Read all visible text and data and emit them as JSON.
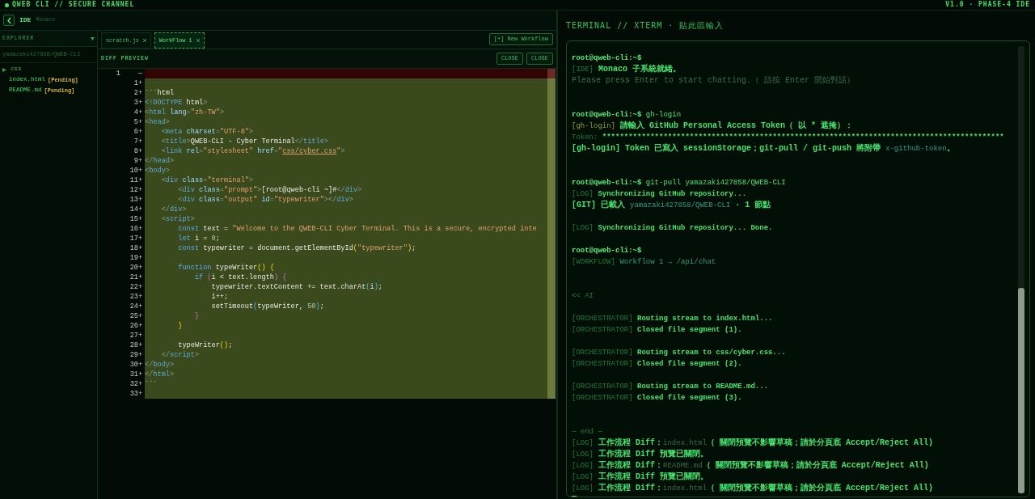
{
  "app": {
    "title": "QWEB CLI // SECURE CHANNEL",
    "version": "V1.0 · PHASE-4 IDE"
  },
  "ide": {
    "title": "IDE",
    "subtitle": "Monaco"
  },
  "explorer": {
    "title": "EXPLORER",
    "repo": "yamazaki427858/QWEB-CLI",
    "items": [
      {
        "kind": "folder",
        "name": "css",
        "expanded": false
      },
      {
        "kind": "file",
        "name": "index.html",
        "badge": "[Pending]"
      },
      {
        "kind": "file",
        "name": "README.md",
        "badge": "[Pending]"
      }
    ]
  },
  "tabs": [
    {
      "label": "scratch.js",
      "selected": false
    },
    {
      "label": "WorkFlow 1",
      "selected": true
    }
  ],
  "new_workflow_button": "[+] New Workflow",
  "diff_preview": {
    "title": "DIFF PREVIEW",
    "buttons": [
      "CLOSE",
      "CLOSE"
    ]
  },
  "code_lines": [
    {
      "kind": "removed",
      "old": "1",
      "sign": "—"
    },
    {
      "kind": "added",
      "new": "1",
      "sign": "+"
    },
    {
      "kind": "added",
      "new": "2",
      "sign": "+",
      "tokens": [
        {
          "kind": "plain",
          "text": "```html"
        }
      ]
    },
    {
      "kind": "added",
      "new": "3",
      "sign": "+",
      "tokens": [
        {
          "kind": "tag",
          "text": "<!DOCTYPE"
        },
        {
          "kind": "plain",
          "text": " html"
        },
        {
          "kind": "punct",
          "text": ">"
        }
      ]
    },
    {
      "kind": "added",
      "new": "4",
      "sign": "+",
      "tokens": [
        {
          "kind": "punct",
          "text": "<"
        },
        {
          "kind": "tag",
          "text": "html"
        },
        {
          "kind": "attr",
          "text": " lang"
        },
        {
          "kind": "punct",
          "text": "="
        },
        {
          "kind": "string",
          "text": "\"zh-TW\""
        },
        {
          "kind": "punct",
          "text": ">"
        }
      ]
    },
    {
      "kind": "added",
      "new": "5",
      "sign": "+",
      "tokens": [
        {
          "kind": "punct",
          "text": "<"
        },
        {
          "kind": "tag",
          "text": "head"
        },
        {
          "kind": "punct",
          "text": ">"
        }
      ]
    },
    {
      "kind": "added",
      "new": "6",
      "sign": "+",
      "tokens": [
        {
          "kind": "punct",
          "text": "    <"
        },
        {
          "kind": "tag",
          "text": "meta"
        },
        {
          "kind": "attr",
          "text": " charset"
        },
        {
          "kind": "punct",
          "text": "="
        },
        {
          "kind": "string",
          "text": "\"UTF-8\""
        },
        {
          "kind": "punct",
          "text": ">"
        }
      ]
    },
    {
      "kind": "added",
      "new": "7",
      "sign": "+",
      "tokens": [
        {
          "kind": "punct",
          "text": "    <"
        },
        {
          "kind": "tag",
          "text": "title"
        },
        {
          "kind": "punct",
          "text": ">"
        },
        {
          "kind": "plain",
          "text": "QWEB-CLI - Cyber Terminal"
        },
        {
          "kind": "punct",
          "text": "</"
        },
        {
          "kind": "tag",
          "text": "title"
        },
        {
          "kind": "punct",
          "text": ">"
        }
      ]
    },
    {
      "kind": "added",
      "new": "8",
      "sign": "+",
      "tokens": [
        {
          "kind": "punct",
          "text": "    <"
        },
        {
          "kind": "tag",
          "text": "link"
        },
        {
          "kind": "attr",
          "text": " rel"
        },
        {
          "kind": "punct",
          "text": "="
        },
        {
          "kind": "string",
          "text": "\"stylesheet\""
        },
        {
          "kind": "attr",
          "text": " href"
        },
        {
          "kind": "punct",
          "text": "="
        },
        {
          "kind": "string",
          "text": "\""
        },
        {
          "kind": "link",
          "text": "css/cyber.css"
        },
        {
          "kind": "string",
          "text": "\""
        },
        {
          "kind": "punct",
          "text": ">"
        }
      ]
    },
    {
      "kind": "added",
      "new": "9",
      "sign": "+",
      "tokens": [
        {
          "kind": "punct",
          "text": "</"
        },
        {
          "kind": "tag",
          "text": "head"
        },
        {
          "kind": "punct",
          "text": ">"
        }
      ]
    },
    {
      "kind": "added",
      "new": "10",
      "sign": "+",
      "tokens": [
        {
          "kind": "punct",
          "text": "<"
        },
        {
          "kind": "tag",
          "text": "body"
        },
        {
          "kind": "punct",
          "text": ">"
        }
      ]
    },
    {
      "kind": "added",
      "new": "11",
      "sign": "+",
      "tokens": [
        {
          "kind": "punct",
          "text": "    <"
        },
        {
          "kind": "tag",
          "text": "div"
        },
        {
          "kind": "attr",
          "text": " class"
        },
        {
          "kind": "punct",
          "text": "="
        },
        {
          "kind": "string",
          "text": "\"terminal\""
        },
        {
          "kind": "punct",
          "text": ">"
        }
      ]
    },
    {
      "kind": "added",
      "new": "12",
      "sign": "+",
      "tokens": [
        {
          "kind": "punct",
          "text": "        <"
        },
        {
          "kind": "tag",
          "text": "div"
        },
        {
          "kind": "attr",
          "text": " class"
        },
        {
          "kind": "punct",
          "text": "="
        },
        {
          "kind": "string",
          "text": "\"prompt\""
        },
        {
          "kind": "punct",
          "text": ">"
        },
        {
          "kind": "plain",
          "text": "[root@qweb-cli ~]#"
        },
        {
          "kind": "punct",
          "text": "</"
        },
        {
          "kind": "tag",
          "text": "div"
        },
        {
          "kind": "punct",
          "text": ">"
        }
      ]
    },
    {
      "kind": "added",
      "new": "13",
      "sign": "+",
      "tokens": [
        {
          "kind": "punct",
          "text": "        <"
        },
        {
          "kind": "tag",
          "text": "div"
        },
        {
          "kind": "attr",
          "text": " class"
        },
        {
          "kind": "punct",
          "text": "="
        },
        {
          "kind": "string",
          "text": "\"output\""
        },
        {
          "kind": "attr",
          "text": " id"
        },
        {
          "kind": "punct",
          "text": "="
        },
        {
          "kind": "string",
          "text": "\"typewriter\""
        },
        {
          "kind": "punct",
          "text": "></"
        },
        {
          "kind": "tag",
          "text": "div"
        },
        {
          "kind": "punct",
          "text": ">"
        }
      ]
    },
    {
      "kind": "added",
      "new": "14",
      "sign": "+",
      "tokens": [
        {
          "kind": "punct",
          "text": "    </"
        },
        {
          "kind": "tag",
          "text": "div"
        },
        {
          "kind": "punct",
          "text": ">"
        }
      ]
    },
    {
      "kind": "added",
      "new": "15",
      "sign": "+",
      "tokens": [
        {
          "kind": "punct",
          "text": "    <"
        },
        {
          "kind": "tag",
          "text": "script"
        },
        {
          "kind": "punct",
          "text": ">"
        }
      ]
    },
    {
      "kind": "added",
      "new": "16",
      "sign": "+",
      "tokens": [
        {
          "kind": "keyword",
          "text": "        const"
        },
        {
          "kind": "plain",
          "text": " text = "
        },
        {
          "kind": "string",
          "text": "\"Welcome to the QWEB-CLI Cyber Terminal. This is a secure, encrypted inte"
        }
      ]
    },
    {
      "kind": "added",
      "new": "17",
      "sign": "+",
      "tokens": [
        {
          "kind": "keyword",
          "text": "        let"
        },
        {
          "kind": "plain",
          "text": " i = "
        },
        {
          "kind": "number",
          "text": "0"
        },
        {
          "kind": "plain",
          "text": ";"
        }
      ]
    },
    {
      "kind": "added",
      "new": "18",
      "sign": "+",
      "tokens": [
        {
          "kind": "keyword",
          "text": "        const"
        },
        {
          "kind": "plain",
          "text": " typewriter = document.getElementById"
        },
        {
          "kind": "brace",
          "text": "("
        },
        {
          "kind": "string",
          "text": "\"typewriter\""
        },
        {
          "kind": "brace",
          "text": ")"
        },
        {
          "kind": "plain",
          "text": ";"
        }
      ]
    },
    {
      "kind": "added",
      "new": "19",
      "sign": "+"
    },
    {
      "kind": "added",
      "new": "20",
      "sign": "+",
      "tokens": [
        {
          "kind": "keyword",
          "text": "        function"
        },
        {
          "kind": "plain",
          "text": " typeWriter"
        },
        {
          "kind": "brace",
          "text": "() {"
        }
      ]
    },
    {
      "kind": "added",
      "new": "21",
      "sign": "+",
      "tokens": [
        {
          "kind": "keyword",
          "text": "            if"
        },
        {
          "kind": "bracket",
          "text": " ("
        },
        {
          "kind": "plain",
          "text": "i < text.length"
        },
        {
          "kind": "bracket",
          "text": ") {"
        }
      ]
    },
    {
      "kind": "added",
      "new": "22",
      "sign": "+",
      "tokens": [
        {
          "kind": "plain",
          "text": "                typewriter.textContent += text.charAt"
        },
        {
          "kind": "call",
          "text": "("
        },
        {
          "kind": "plain",
          "text": "i"
        },
        {
          "kind": "call",
          "text": ")"
        },
        {
          "kind": "plain",
          "text": ";"
        }
      ]
    },
    {
      "kind": "added",
      "new": "23",
      "sign": "+",
      "tokens": [
        {
          "kind": "plain",
          "text": "                i++;"
        }
      ]
    },
    {
      "kind": "added",
      "new": "24",
      "sign": "+",
      "tokens": [
        {
          "kind": "plain",
          "text": "                setTimeout"
        },
        {
          "kind": "call",
          "text": "("
        },
        {
          "kind": "plain",
          "text": "typeWriter, "
        },
        {
          "kind": "number",
          "text": "50"
        },
        {
          "kind": "call",
          "text": ")"
        },
        {
          "kind": "plain",
          "text": ";"
        }
      ]
    },
    {
      "kind": "added",
      "new": "25",
      "sign": "+",
      "tokens": [
        {
          "kind": "bracket",
          "text": "            }"
        }
      ]
    },
    {
      "kind": "added",
      "new": "26",
      "sign": "+",
      "tokens": [
        {
          "kind": "brace",
          "text": "        }"
        }
      ]
    },
    {
      "kind": "added",
      "new": "27",
      "sign": "+"
    },
    {
      "kind": "added",
      "new": "28",
      "sign": "+",
      "tokens": [
        {
          "kind": "plain",
          "text": "        typeWriter"
        },
        {
          "kind": "brace",
          "text": "()"
        },
        {
          "kind": "plain",
          "text": ";"
        }
      ]
    },
    {
      "kind": "added",
      "new": "29",
      "sign": "+",
      "tokens": [
        {
          "kind": "punct",
          "text": "    </"
        },
        {
          "kind": "tag",
          "text": "script"
        },
        {
          "kind": "punct",
          "text": ">"
        }
      ]
    },
    {
      "kind": "added",
      "new": "30",
      "sign": "+",
      "tokens": [
        {
          "kind": "punct",
          "text": "</"
        },
        {
          "kind": "tag",
          "text": "body"
        },
        {
          "kind": "punct",
          "text": ">"
        }
      ]
    },
    {
      "kind": "added",
      "new": "31",
      "sign": "+",
      "tokens": [
        {
          "kind": "punct",
          "text": "</"
        },
        {
          "kind": "tag",
          "text": "html"
        },
        {
          "kind": "punct",
          "text": ">"
        }
      ]
    },
    {
      "kind": "added",
      "new": "32",
      "sign": "+",
      "tokens": [
        {
          "kind": "plain",
          "text": "```"
        }
      ]
    },
    {
      "kind": "added",
      "new": "33",
      "sign": "+"
    }
  ],
  "terminal": {
    "title": "TERMINAL // XTERM · 貼此區輸入",
    "lines": [
      {
        "kind": "line",
        "segments": [
          {
            "kind": "prompt",
            "text": "root@qweb-cli:~$"
          }
        ]
      },
      {
        "kind": "line",
        "segments": [
          {
            "kind": "tag",
            "text": "[IDE]"
          },
          {
            "kind": "text",
            "text": " Monaco 子系統就緒。"
          }
        ]
      },
      {
        "kind": "line",
        "segments": [
          {
            "kind": "muted",
            "text": "Please press Enter to start chatting.（ 請按 Enter 開始對話）"
          }
        ]
      },
      {
        "kind": "blank"
      },
      {
        "kind": "blank"
      },
      {
        "kind": "line",
        "segments": [
          {
            "kind": "prompt",
            "text": "root@qweb-cli:~$"
          },
          {
            "kind": "command",
            "text": " gh-login"
          }
        ]
      },
      {
        "kind": "line",
        "segments": [
          {
            "kind": "warn",
            "text": "[gh-login]"
          },
          {
            "kind": "text",
            "text": " 請輸入 GitHub Personal Access Token（ 以 * 遮掩）："
          }
        ]
      },
      {
        "kind": "line",
        "segments": [
          {
            "kind": "tag",
            "text": "Token:"
          },
          {
            "kind": "text",
            "text": " ********************************************************************************************"
          }
        ]
      },
      {
        "kind": "line",
        "segments": [
          {
            "kind": "text",
            "text": "[gh-login] Token 已寫入 sessionStorage；git-pull / git-push 將附帶 "
          },
          {
            "kind": "path",
            "text": "x-github-token"
          },
          {
            "kind": "text",
            "text": "。"
          }
        ]
      },
      {
        "kind": "blank"
      },
      {
        "kind": "blank"
      },
      {
        "kind": "line",
        "segments": [
          {
            "kind": "prompt",
            "text": "root@qweb-cli:~$"
          },
          {
            "kind": "command",
            "text": " git-pull yamazaki427858/QWEB-CLI"
          }
        ]
      },
      {
        "kind": "line",
        "segments": [
          {
            "kind": "tag",
            "text": "[LOG]"
          },
          {
            "kind": "text",
            "text": " Synchronizing GitHub repository..."
          }
        ]
      },
      {
        "kind": "line",
        "segments": [
          {
            "kind": "text",
            "text": "[GIT] 已載入 "
          },
          {
            "kind": "path",
            "text": "yamazaki427858/QWEB-CLI"
          },
          {
            "kind": "text",
            "text": " · 1 節點"
          }
        ]
      },
      {
        "kind": "blank"
      },
      {
        "kind": "line",
        "segments": [
          {
            "kind": "tag",
            "text": "[LOG]"
          },
          {
            "kind": "text",
            "text": " Synchronizing GitHub repository... Done."
          }
        ]
      },
      {
        "kind": "blank"
      },
      {
        "kind": "line",
        "segments": [
          {
            "kind": "prompt",
            "text": "root@qweb-cli:~$"
          }
        ]
      },
      {
        "kind": "line",
        "segments": [
          {
            "kind": "tag",
            "text": "[WORKFLOW]"
          },
          {
            "kind": "path",
            "text": " Workflow 1 → /api/chat"
          }
        ]
      },
      {
        "kind": "blank"
      },
      {
        "kind": "blank"
      },
      {
        "kind": "line",
        "segments": [
          {
            "kind": "tag",
            "text": "<< AI"
          }
        ]
      },
      {
        "kind": "blank"
      },
      {
        "kind": "line",
        "segments": [
          {
            "kind": "tag",
            "text": "[ORCHESTRATOR]"
          },
          {
            "kind": "text",
            "text": " Routing stream to index.html..."
          }
        ]
      },
      {
        "kind": "line",
        "segments": [
          {
            "kind": "tag",
            "text": "[ORCHESTRATOR]"
          },
          {
            "kind": "text",
            "text": " Closed file segment (1)."
          }
        ]
      },
      {
        "kind": "blank"
      },
      {
        "kind": "line",
        "segments": [
          {
            "kind": "tag",
            "text": "[ORCHESTRATOR]"
          },
          {
            "kind": "text",
            "text": " Routing stream to css/cyber.css..."
          }
        ]
      },
      {
        "kind": "line",
        "segments": [
          {
            "kind": "tag",
            "text": "[ORCHESTRATOR]"
          },
          {
            "kind": "text",
            "text": " Closed file segment (2)."
          }
        ]
      },
      {
        "kind": "blank"
      },
      {
        "kind": "line",
        "segments": [
          {
            "kind": "tag",
            "text": "[ORCHESTRATOR]"
          },
          {
            "kind": "text",
            "text": " Routing stream to README.md..."
          }
        ]
      },
      {
        "kind": "line",
        "segments": [
          {
            "kind": "tag",
            "text": "[ORCHESTRATOR]"
          },
          {
            "kind": "text",
            "text": " Closed file segment (3)."
          }
        ]
      },
      {
        "kind": "blank"
      },
      {
        "kind": "blank"
      },
      {
        "kind": "line",
        "segments": [
          {
            "kind": "tag",
            "text": "— end —"
          }
        ]
      },
      {
        "kind": "line",
        "segments": [
          {
            "kind": "tag",
            "text": "[LOG]"
          },
          {
            "kind": "text",
            "text": " 工作流程 Diff："
          },
          {
            "kind": "muted",
            "text": "index.html"
          },
          {
            "kind": "text",
            "text": "（ 關閉預覽不影響草稿；請於分頁底 Accept/Reject All)"
          }
        ]
      },
      {
        "kind": "line",
        "segments": [
          {
            "kind": "tag",
            "text": "[LOG]"
          },
          {
            "kind": "text",
            "text": " 工作流程 Diff 預覽已關閉。"
          }
        ]
      },
      {
        "kind": "line",
        "segments": [
          {
            "kind": "tag",
            "text": "[LOG]"
          },
          {
            "kind": "text",
            "text": " 工作流程 Diff："
          },
          {
            "kind": "muted",
            "text": "README.md"
          },
          {
            "kind": "text",
            "text": "（ 關閉預覽不影響草稿；請於分頁底 Accept/Reject All)"
          }
        ]
      },
      {
        "kind": "line",
        "segments": [
          {
            "kind": "tag",
            "text": "[LOG]"
          },
          {
            "kind": "text",
            "text": " 工作流程 Diff 預覽已關閉。"
          }
        ]
      },
      {
        "kind": "line",
        "segments": [
          {
            "kind": "tag",
            "text": "[LOG]"
          },
          {
            "kind": "text",
            "text": " 工作流程 Diff："
          },
          {
            "kind": "muted",
            "text": "index.html"
          },
          {
            "kind": "text",
            "text": "（ 關閉預覽不影響草稿；請於分頁底 Accept/Reject All)"
          }
        ]
      }
    ]
  }
}
